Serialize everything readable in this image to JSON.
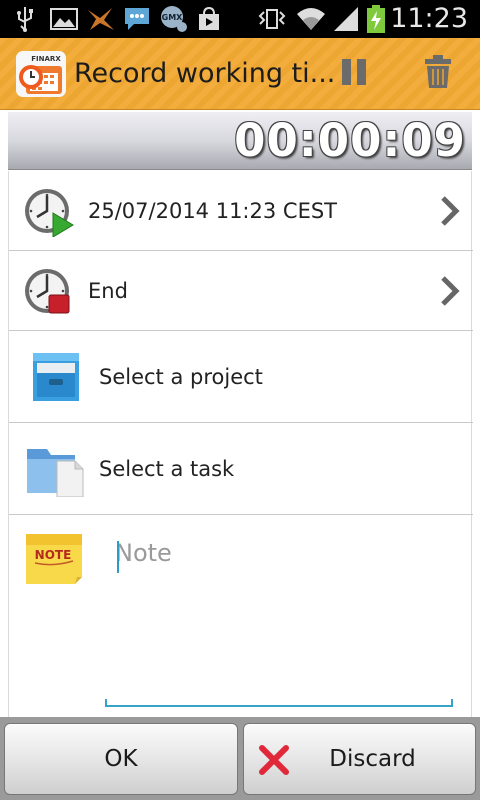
{
  "status_bar": {
    "time": "11:23",
    "icons": [
      "usb-icon",
      "image-icon",
      "bird-app-icon",
      "chat-icon",
      "gmx-icon",
      "store-icon",
      "vibrate-icon",
      "wifi-icon",
      "signal-icon",
      "battery-charging-icon"
    ],
    "gmx_label": "GMX"
  },
  "action_bar": {
    "app_logo_text": "FINARX",
    "title": "Record working ti...",
    "icons": [
      "pause-icon",
      "trash-icon"
    ]
  },
  "timer": {
    "value": "00:00:09"
  },
  "rows": {
    "start": {
      "label": "25/07/2014 11:23 CEST",
      "icon": "clock-play-icon"
    },
    "end": {
      "label": "End",
      "icon": "clock-stop-icon"
    },
    "project": {
      "label": "Select a project",
      "icon": "drawer-icon"
    },
    "task": {
      "label": "Select a task",
      "icon": "folder-document-icon"
    },
    "note": {
      "icon_text": "NOTE",
      "placeholder": "Note",
      "value": ""
    }
  },
  "buttons": {
    "ok": "OK",
    "discard": "Discard"
  },
  "colors": {
    "action_bar": "#f2ad3c",
    "accent_blue": "#35a2c9",
    "discard_red": "#e0283a"
  }
}
